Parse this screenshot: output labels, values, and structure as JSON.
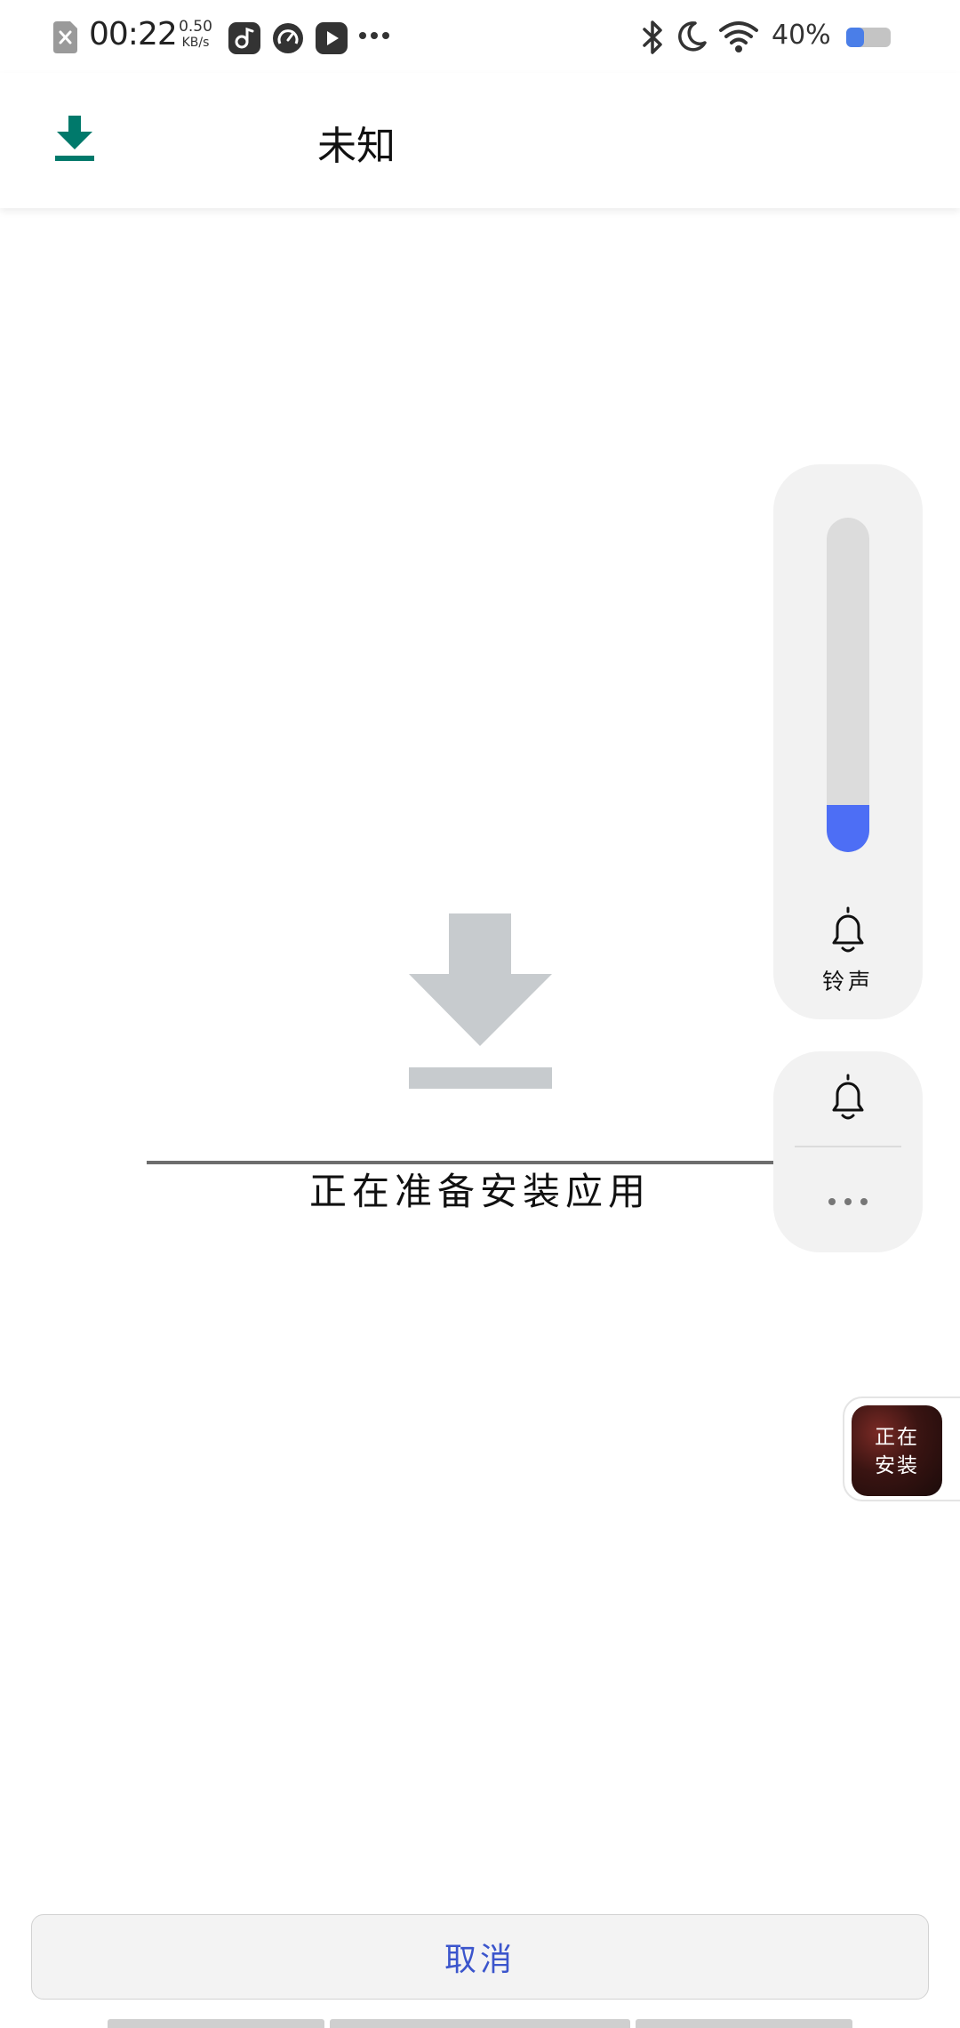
{
  "status_bar": {
    "time": "00:22",
    "net_speed_value": "0.50",
    "net_speed_unit": "KB/s",
    "battery_percent": "40%",
    "icons": [
      "sim-error-icon",
      "music-app-icon",
      "speed-app-icon",
      "video-app-icon",
      "more-icon",
      "bluetooth-icon",
      "do-not-disturb-moon-icon",
      "wifi-icon",
      "battery-icon"
    ],
    "battery_level": 0.4
  },
  "app_bar": {
    "title": "未知",
    "icon": "download-icon",
    "accent": "#00796b"
  },
  "main": {
    "status_text": "正在准备安装应用",
    "icon": "download-icon",
    "icon_color": "#c7cbce"
  },
  "volume_panel": {
    "label": "铃声",
    "level": 0.14,
    "fill_color": "#4d6ef5",
    "icons": [
      "bell-icon"
    ]
  },
  "ringer_panel": {
    "icons": [
      "bell-icon",
      "more-icon"
    ]
  },
  "install_float": {
    "label": "正在\n安装"
  },
  "cancel_button": {
    "label": "取消",
    "color": "#3b55cc"
  }
}
